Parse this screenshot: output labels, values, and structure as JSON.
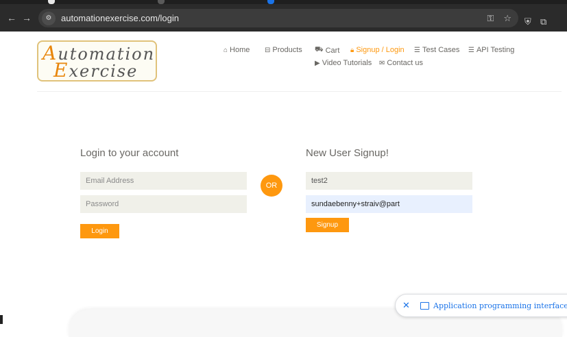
{
  "browser": {
    "url": "automationexercise.com/login",
    "back_icon": "←",
    "forward_icon": "→",
    "reload_icon": "C",
    "site_info_icon": "⚙",
    "key_icon": "⚿",
    "star_icon": "☆",
    "shield_icon": "⛨",
    "extensions_icon": "⧉"
  },
  "logo": {
    "line1_cap": "A",
    "line1_rest": "utomation",
    "line2_cap": "E",
    "line2_rest": "xercise"
  },
  "nav": {
    "home": "Home",
    "products": "Products",
    "cart": "Cart",
    "signup_login": "Signup / Login",
    "test_cases": "Test Cases",
    "api_testing": "API Testing",
    "video_tutorials": "Video Tutorials",
    "contact_us": "Contact us",
    "active_color": "#fe980f"
  },
  "login": {
    "title": "Login to your account",
    "email_placeholder": "Email Address",
    "password_placeholder": "Password",
    "button": "Login"
  },
  "or_label": "OR",
  "signup": {
    "title": "New User Signup!",
    "name_value": "test2",
    "email_value": "sundaebenny+straiv@part",
    "button": "Signup"
  },
  "toast": {
    "close": "✕",
    "text": "Application programming interface"
  },
  "colors": {
    "accent": "#fe980f",
    "input_bg": "#f0f0e9",
    "autofill_bg": "#e8f0fe"
  }
}
